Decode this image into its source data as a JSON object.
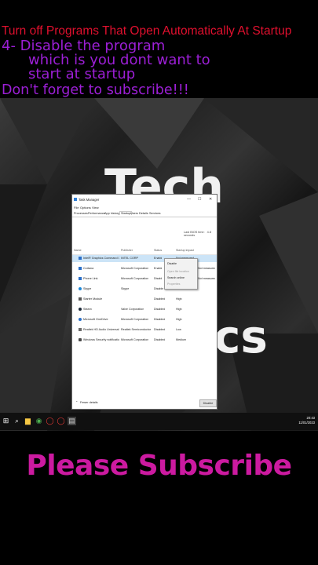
{
  "header": {
    "line1": "Turn off Programs That Open Automatically At Startup",
    "line2": "4- Disable the program",
    "line3": "which is you dont want to",
    "line4": "start at startup",
    "line5": "Don't forget to subscribe!!!"
  },
  "background": {
    "word1": "Tech",
    "word2": "cs"
  },
  "window": {
    "title": "Task Manager",
    "controls": {
      "minimize": "—",
      "maximize": "☐",
      "close": "✕"
    },
    "menu": [
      "File",
      "Options",
      "View"
    ],
    "tabs": [
      "Processes",
      "Performance",
      "App history",
      "Startup",
      "Users",
      "Details",
      "Services"
    ],
    "active_tab": "Startup",
    "bios_label": "Last BIOS time:",
    "bios_value": "4.8 seconds",
    "columns": [
      "Name",
      "Publisher",
      "Status",
      "Startup impact"
    ],
    "rows": [
      {
        "name": "Intel® Graphics Command C...",
        "publisher": "INTEL CORP",
        "status": "Enabled",
        "impact": "Not measured",
        "icon_color": "#2a6fc9"
      },
      {
        "name": "Cortana",
        "publisher": "Microsoft Corporation",
        "status": "Enabled",
        "impact": "Not measured",
        "icon_color": "#2a6fc9"
      },
      {
        "name": "Phone Link",
        "publisher": "Microsoft Corporation",
        "status": "Disabled",
        "impact": "Not measured",
        "icon_color": "#2a6fc9"
      },
      {
        "name": "Skype",
        "publisher": "Skype",
        "status": "Disabled",
        "impact": "None",
        "icon_color": "#1e88d8"
      },
      {
        "name": "Starter Module",
        "publisher": "",
        "status": "Disabled",
        "impact": "High",
        "icon_color": "#555555"
      },
      {
        "name": "Steam",
        "publisher": "Valve Corporation",
        "status": "Disabled",
        "impact": "High",
        "icon_color": "#1b2838"
      },
      {
        "name": "Microsoft OneDrive",
        "publisher": "Microsoft Corporation",
        "status": "Disabled",
        "impact": "High",
        "icon_color": "#2a6fc9"
      },
      {
        "name": "Realtek HD Audio Universal ...",
        "publisher": "Realtek Semiconductor",
        "status": "Disabled",
        "impact": "Low",
        "icon_color": "#6a6a6a"
      },
      {
        "name": "Windows Security notificatio...",
        "publisher": "Microsoft Corporation",
        "status": "Disabled",
        "impact": "Medium",
        "icon_color": "#4a4a4a"
      }
    ],
    "context_menu": [
      "Disable",
      "Open file location",
      "Search online",
      "Properties"
    ],
    "fewer_details": "Fewer details",
    "disable_button": "Disable"
  },
  "taskbar": {
    "time": "20:43",
    "date": "11/01/2023"
  },
  "footer": {
    "subscribe": "Please Subscribe"
  }
}
